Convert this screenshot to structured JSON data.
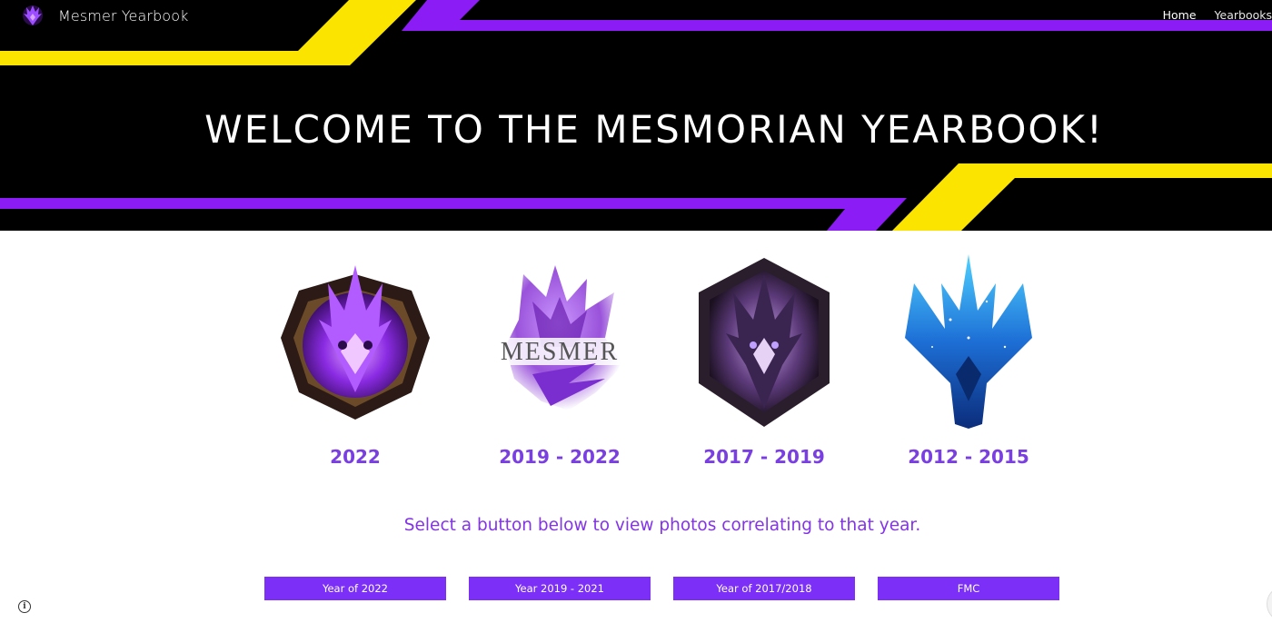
{
  "site": {
    "title": "Mesmer Yearbook",
    "logo_icon": "dragon-crest-icon"
  },
  "nav": {
    "items": [
      {
        "label": "Home",
        "active": true
      },
      {
        "label": "Yearbooks",
        "active": false
      }
    ]
  },
  "hero": {
    "heading": "WELCOME TO THE MESMORIAN YEARBOOK!",
    "colors": {
      "background": "#000000",
      "yellow": "#fbe400",
      "purple": "#8b1cf5"
    }
  },
  "emblems": [
    {
      "year": "2022",
      "icon": "purple-dragon-crest-icon"
    },
    {
      "year": "2019 - 2022",
      "icon": "mesmer-wordmark-crest-icon",
      "wordmark": "MESMER"
    },
    {
      "year": "2017 - 2019",
      "icon": "dark-hexagon-dragon-crest-icon"
    },
    {
      "year": "2012 - 2015",
      "icon": "blue-galaxy-dragon-crest-icon"
    }
  ],
  "instruction": "Select a button below to view photos correlating to that year.",
  "buttons": [
    {
      "label": "Year of 2022"
    },
    {
      "label": "Year 2019 - 2021"
    },
    {
      "label": "Year of 2017/2018"
    },
    {
      "label": "FMC"
    }
  ],
  "colors": {
    "accent_text": "#7a3fe0",
    "button": "#7b2ff7"
  }
}
